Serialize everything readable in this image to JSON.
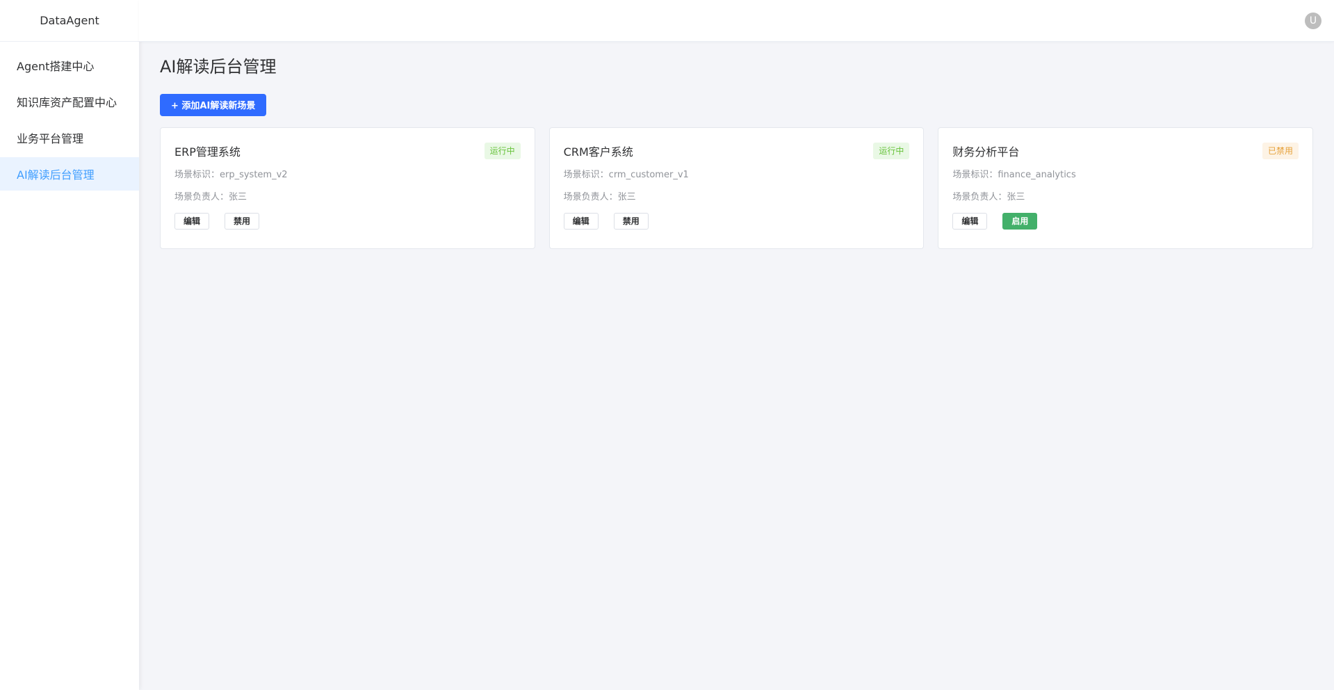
{
  "brand": "DataAgent",
  "nav": [
    {
      "label": "Agent搭建中心",
      "active": false
    },
    {
      "label": "知识库资产配置中心",
      "active": false
    },
    {
      "label": "业务平台管理",
      "active": false
    },
    {
      "label": "AI解读后台管理",
      "active": true
    }
  ],
  "user": {
    "avatar_letter": "U"
  },
  "page": {
    "title": "AI解读后台管理",
    "add_button": "+ 添加AI解读新场景"
  },
  "colors": {
    "primary": "#2f6bff",
    "active_nav": "#409eff",
    "running": "#67c23a",
    "disabled": "#e6a23c",
    "enable_button": "#43b06a"
  },
  "scenes": [
    {
      "title": "ERP管理系统",
      "status": "运行中",
      "status_type": "running",
      "id_line": "场景标识：erp_system_v2",
      "owner_line": "场景负责人：张三",
      "edit_label": "编辑",
      "toggle_label": "禁用",
      "toggle_type": "disable"
    },
    {
      "title": "CRM客户系统",
      "status": "运行中",
      "status_type": "running",
      "id_line": "场景标识：crm_customer_v1",
      "owner_line": "场景负责人：张三",
      "edit_label": "编辑",
      "toggle_label": "禁用",
      "toggle_type": "disable"
    },
    {
      "title": "财务分析平台",
      "status": "已禁用",
      "status_type": "disabled",
      "id_line": "场景标识：finance_analytics",
      "owner_line": "场景负责人：张三",
      "edit_label": "编辑",
      "toggle_label": "启用",
      "toggle_type": "enable"
    }
  ]
}
